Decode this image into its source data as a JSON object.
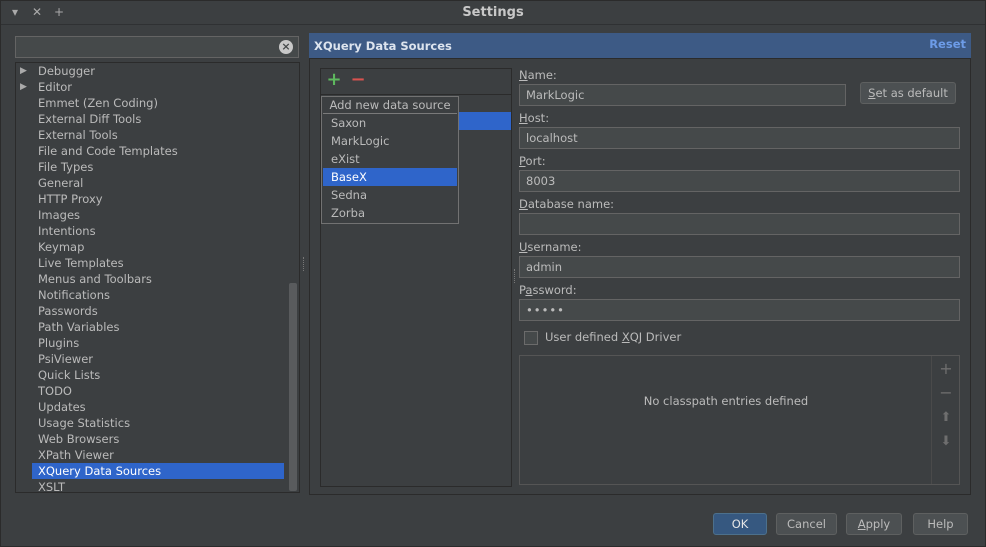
{
  "window": {
    "title": "Settings",
    "controls": {
      "menu": "▾",
      "close": "✕",
      "add": "+"
    }
  },
  "search": {
    "value": "",
    "placeholder": ""
  },
  "tree": {
    "items": [
      {
        "label": "Debugger",
        "expandable": true
      },
      {
        "label": "Editor",
        "expandable": true
      },
      {
        "label": "Emmet (Zen Coding)"
      },
      {
        "label": "External Diff Tools"
      },
      {
        "label": "External Tools"
      },
      {
        "label": "File and Code Templates"
      },
      {
        "label": "File Types"
      },
      {
        "label": "General"
      },
      {
        "label": "HTTP Proxy"
      },
      {
        "label": "Images"
      },
      {
        "label": "Intentions"
      },
      {
        "label": "Keymap"
      },
      {
        "label": "Live Templates"
      },
      {
        "label": "Menus and Toolbars"
      },
      {
        "label": "Notifications"
      },
      {
        "label": "Passwords"
      },
      {
        "label": "Path Variables"
      },
      {
        "label": "Plugins"
      },
      {
        "label": "PsiViewer"
      },
      {
        "label": "Quick Lists"
      },
      {
        "label": "TODO"
      },
      {
        "label": "Updates"
      },
      {
        "label": "Usage Statistics"
      },
      {
        "label": "Web Browsers"
      },
      {
        "label": "XPath Viewer"
      },
      {
        "label": "XQuery Data Sources",
        "selected": true
      },
      {
        "label": "XSLT"
      }
    ]
  },
  "panel": {
    "title": "XQuery Data Sources",
    "reset_label": "Reset"
  },
  "sources": {
    "add_icon": "+",
    "remove_icon": "−",
    "popup": {
      "title": "Add new data source",
      "items": [
        {
          "label": "Saxon"
        },
        {
          "label": "MarkLogic"
        },
        {
          "label": "eXist"
        },
        {
          "label": "BaseX",
          "selected": true
        },
        {
          "label": "Sedna"
        },
        {
          "label": "Zorba"
        }
      ]
    }
  },
  "form": {
    "name": {
      "label_u": "N",
      "label_rest": "ame:",
      "value": "MarkLogic"
    },
    "set_default": {
      "label_u": "S",
      "label_rest": "et as default"
    },
    "host": {
      "label_u": "H",
      "label_rest": "ost:",
      "value": "localhost"
    },
    "port": {
      "label_u": "P",
      "label_rest": "ort:",
      "value": "8003"
    },
    "database": {
      "label_u": "D",
      "label_rest": "atabase name:",
      "value": ""
    },
    "username": {
      "label_u": "U",
      "label_rest": "sername:",
      "value": "admin"
    },
    "password": {
      "label_pre": "P",
      "label_u": "a",
      "label_rest": "ssword:",
      "value": "•••••"
    },
    "xqj": {
      "label_pre": "User defined ",
      "label_u": "X",
      "label_rest": "QJ Driver",
      "checked": false
    },
    "classpath": {
      "empty_text": "No classpath entries defined",
      "buttons": {
        "add": "+",
        "remove": "−",
        "up": "⬆",
        "down": "⬇"
      }
    }
  },
  "footer": {
    "ok": "OK",
    "cancel": "Cancel",
    "apply_u": "A",
    "apply_rest": "pply",
    "help": "Help"
  },
  "colors": {
    "background": "#3c3f41",
    "selection": "#2f65ca",
    "header": "#3d5a85",
    "add_green": "#5eb85e",
    "remove_red": "#d9534f",
    "link": "#6d9ce8"
  }
}
